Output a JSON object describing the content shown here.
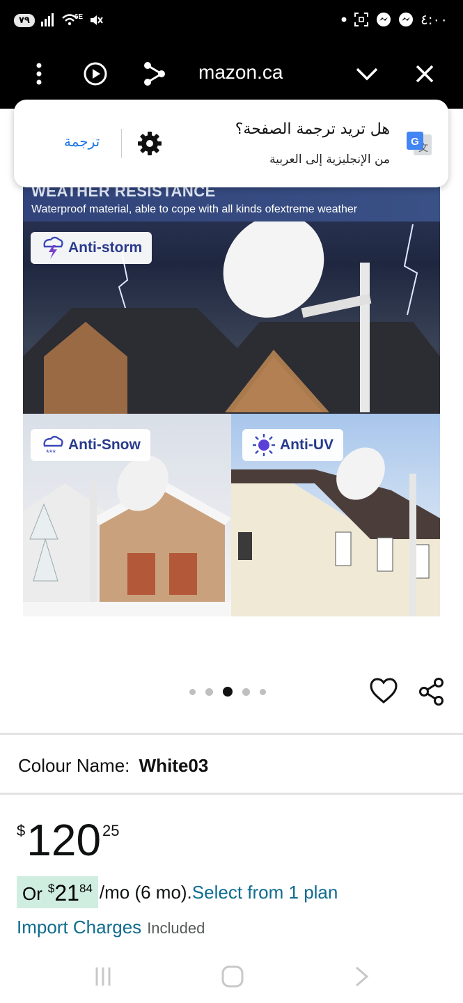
{
  "status_bar": {
    "battery": "٧٩",
    "network": "6E",
    "time": "٤:٠٠",
    "icons": [
      "signal-icon",
      "wifi-icon",
      "mute-icon",
      "dot-icon",
      "screenshot-icon",
      "messenger-icon",
      "messenger-icon"
    ]
  },
  "browser": {
    "url": "mazon.ca",
    "icons": [
      "menu-icon",
      "play-icon",
      "share-icon",
      "chevron-down-icon",
      "close-icon"
    ]
  },
  "translate_prompt": {
    "title": "هل تريد ترجمة الصفحة؟",
    "subtitle": "من الإنجليزية إلى العربية",
    "action": "ترجمة",
    "icons": [
      "gear-icon",
      "google-translate-icon"
    ]
  },
  "product_image": {
    "heading": "WEATHER RESISTANCE",
    "caption": "Waterproof material, able to cope with all kinds ofextreme weather",
    "badges": [
      {
        "label": "Anti-storm",
        "icon": "storm-icon"
      },
      {
        "label": "Anti-Snow",
        "icon": "snow-icon"
      },
      {
        "label": "Anti-UV",
        "icon": "sun-icon"
      }
    ],
    "carousel": {
      "count": 5,
      "active_index": 2
    }
  },
  "product": {
    "colour_label": "Colour Name:",
    "colour_value": "White03",
    "price": {
      "symbol": "$",
      "whole": "120",
      "fraction": "25"
    },
    "plan": {
      "or": "Or",
      "symbol": "$",
      "whole": "21",
      "fraction": "84",
      "rest": "/mo (6 mo).",
      "link": "Select from 1 plan"
    },
    "import_charges": {
      "label": "Import Charges",
      "value": "Included"
    },
    "icons": [
      "heart-icon",
      "share-icon"
    ]
  },
  "nav_bar": {
    "icons": [
      "recents-icon",
      "home-icon",
      "back-icon"
    ]
  },
  "colors": {
    "accent_link": "#0f6c8f",
    "plan_highlight": "#cfeee0",
    "translate_blue": "#1a73e8",
    "badge_text": "#283a8c"
  }
}
